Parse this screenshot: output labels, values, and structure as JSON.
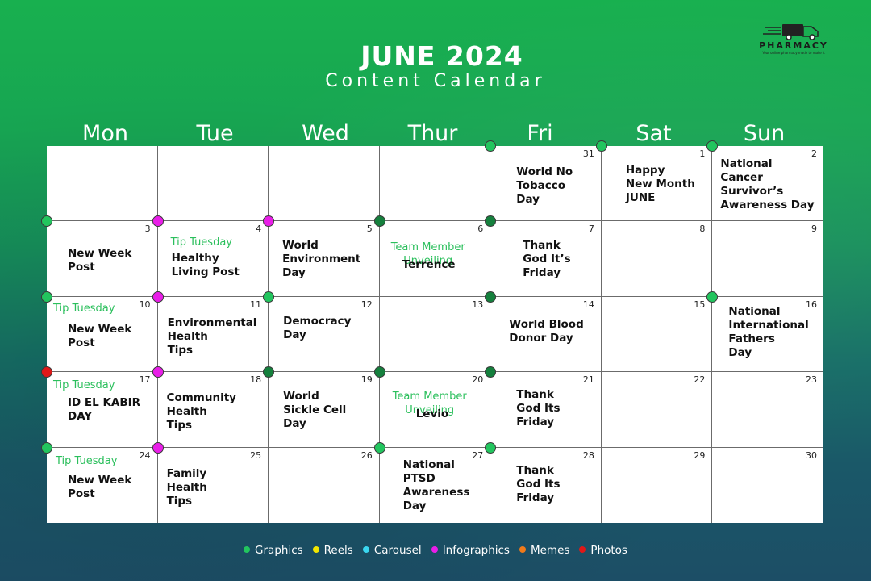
{
  "title": "JUNE 2024",
  "subtitle": "Content Calendar",
  "logo": {
    "name": "PHARMACY",
    "tagline": "Your online pharmacy made to make it"
  },
  "day_headers": [
    "Mon",
    "Tue",
    "Wed",
    "Thur",
    "Fri",
    "Sat",
    "Sun"
  ],
  "colors": {
    "graphics": "#22c55e",
    "graphics_dark": "#15803d",
    "reels": "#f2e600",
    "carousel": "#3ad7f0",
    "infographics": "#e91ee8",
    "memes": "#f07a1a",
    "photos": "#e01818",
    "tip": "#2bbf5c"
  },
  "cells": [
    {
      "num": "",
      "tip": "",
      "event": ""
    },
    {
      "num": "",
      "tip": "",
      "event": ""
    },
    {
      "num": "",
      "tip": "",
      "event": ""
    },
    {
      "num": "",
      "tip": "",
      "event": ""
    },
    {
      "num": "31",
      "tip": "",
      "event": "World No\nTobacco\nDay"
    },
    {
      "num": "1",
      "tip": "",
      "event": "Happy\nNew Month\nJUNE"
    },
    {
      "num": "2",
      "tip": "",
      "event": "National\nCancer\nSurvivor’s\nAwareness Day"
    },
    {
      "num": "3",
      "tip": "",
      "event": "New  Week\nPost"
    },
    {
      "num": "4",
      "tip": "Tip Tuesday",
      "event": "Healthy\nLiving Post"
    },
    {
      "num": "5",
      "tip": "",
      "event": "World\nEnvironment\nDay"
    },
    {
      "num": "6",
      "tip": "Team Member\nUnveiling",
      "event": "Terrence"
    },
    {
      "num": "7",
      "tip": "",
      "event": "Thank\nGod It’s\nFriday"
    },
    {
      "num": "8",
      "tip": "",
      "event": ""
    },
    {
      "num": "9",
      "tip": "",
      "event": ""
    },
    {
      "num": "10",
      "tip": "Tip Tuesday",
      "event": "New  Week\nPost"
    },
    {
      "num": "11",
      "tip": "",
      "event": "Environmental\nHealth\nTips"
    },
    {
      "num": "12",
      "tip": "",
      "event": "Democracy\nDay"
    },
    {
      "num": "13",
      "tip": "",
      "event": ""
    },
    {
      "num": "14",
      "tip": "",
      "event": "World Blood\nDonor Day"
    },
    {
      "num": "15",
      "tip": "",
      "event": ""
    },
    {
      "num": "16",
      "tip": "",
      "event": "National\nInternational\nFathers\nDay"
    },
    {
      "num": "17",
      "tip": "Tip Tuesday",
      "event": "ID EL KABIR\nDAY"
    },
    {
      "num": "18",
      "tip": "",
      "event": "Community\nHealth\nTips"
    },
    {
      "num": "19",
      "tip": "",
      "event": "World\nSickle Cell\nDay"
    },
    {
      "num": "20",
      "tip": "Team Member\nUnveiling",
      "event": "Levio"
    },
    {
      "num": "21",
      "tip": "",
      "event": "Thank\nGod Its\nFriday"
    },
    {
      "num": "22",
      "tip": "",
      "event": ""
    },
    {
      "num": "23",
      "tip": "",
      "event": ""
    },
    {
      "num": "24",
      "tip": "Tip Tuesday",
      "event": "New  Week\nPost"
    },
    {
      "num": "25",
      "tip": "",
      "event": "Family\nHealth\nTips"
    },
    {
      "num": "26",
      "tip": "",
      "event": ""
    },
    {
      "num": "27",
      "tip": "",
      "event": "National\nPTSD\nAwareness\nDay"
    },
    {
      "num": "28",
      "tip": "",
      "event": "Thank\nGod Its\nFriday"
    },
    {
      "num": "29",
      "tip": "",
      "event": ""
    },
    {
      "num": "30",
      "tip": "",
      "event": ""
    }
  ],
  "markers": [
    {
      "type": "graphics"
    },
    {
      "type": "graphics"
    },
    {
      "type": "graphics"
    },
    {
      "type": "graphics"
    },
    {
      "type": "infographics"
    },
    {
      "type": "infographics"
    },
    {
      "type": "graphics_dark"
    },
    {
      "type": "graphics_dark"
    },
    {
      "type": "graphics"
    },
    {
      "type": "infographics"
    },
    {
      "type": "graphics"
    },
    {
      "type": "graphics_dark"
    },
    {
      "type": "graphics"
    },
    {
      "type": "photos"
    },
    {
      "type": "infographics"
    },
    {
      "type": "graphics_dark"
    },
    {
      "type": "graphics_dark"
    },
    {
      "type": "graphics_dark"
    },
    {
      "type": "graphics"
    },
    {
      "type": "infographics"
    },
    {
      "type": "graphics"
    },
    {
      "type": "graphics"
    }
  ],
  "legend": [
    {
      "label": "Graphics",
      "type": "graphics"
    },
    {
      "label": "Reels",
      "type": "reels"
    },
    {
      "label": "Carousel",
      "type": "carousel"
    },
    {
      "label": "Infographics",
      "type": "infographics"
    },
    {
      "label": "Memes",
      "type": "memes"
    },
    {
      "label": "Photos",
      "type": "photos"
    }
  ]
}
